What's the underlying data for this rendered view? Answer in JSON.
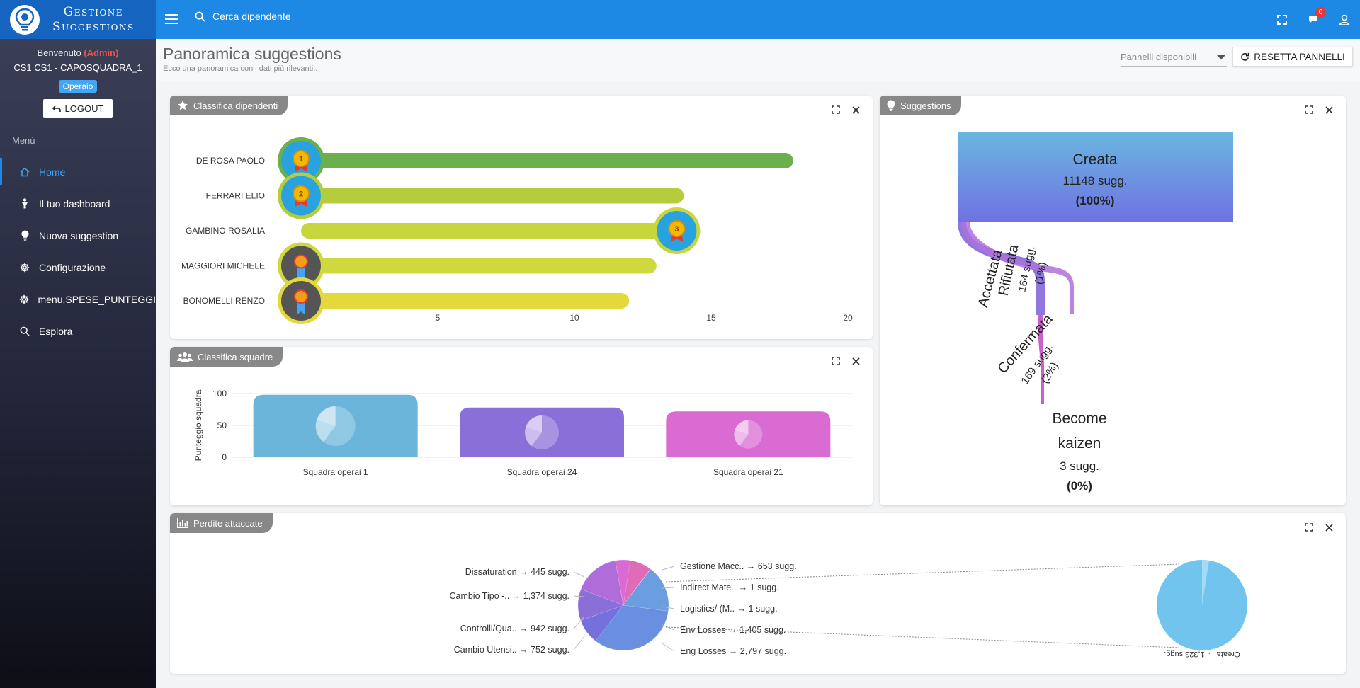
{
  "brand": {
    "line1": "Gestione",
    "line2": "Suggestions"
  },
  "topbar": {
    "search_placeholder": "Cerca dipendente",
    "icons": [
      "fullscreen-icon",
      "chat-icon",
      "user-icon"
    ],
    "notifications_count": "0",
    "colors": {
      "bar": "#1e88e5",
      "brand": "#1565c0",
      "badge": "#e53935"
    }
  },
  "sidebar": {
    "welcome": "Benvenuto",
    "admin": "(Admin)",
    "user": "CS1 CS1 - CAPOSQUADRA_1",
    "role": "Operaio",
    "logout": "LOGOUT",
    "menu_title": "Menù",
    "items": [
      {
        "label": "Home",
        "icon": "home-icon",
        "active": true
      },
      {
        "label": "Il tuo dashboard",
        "icon": "person-icon",
        "active": false
      },
      {
        "label": "Nuova suggestion",
        "icon": "lightbulb-icon",
        "active": false
      },
      {
        "label": "Configurazione",
        "icon": "gear-icon",
        "active": false
      },
      {
        "label": "menu.SPESE_PUNTEGGI",
        "icon": "gear-icon",
        "active": false
      },
      {
        "label": "Esplora",
        "icon": "search-icon",
        "active": false
      }
    ]
  },
  "header": {
    "title": "Panoramica suggestions",
    "subtitle": "Ecco una panoramica con i dati più rilevanti..",
    "select_placeholder": "Pannelli disponibili",
    "reset": "RESETTA PANNELLI"
  },
  "cards": {
    "dipendenti": {
      "title": "Classifica dipendenti",
      "icon": "star-icon"
    },
    "squadre": {
      "title": "Classifica squadre",
      "icon": "group-icon"
    },
    "suggestions": {
      "title": "Suggestions",
      "icon": "lightbulb-icon"
    },
    "perdite": {
      "title": "Perdite attaccate",
      "icon": "bar-chart-icon"
    }
  },
  "chart_data": [
    {
      "id": "classifica-dipendenti",
      "type": "bar",
      "orientation": "horizontal",
      "categories": [
        "DE ROSA PAOLO",
        "FERRARI ELIO",
        "GAMBINO ROSALIA",
        "MAGGIORI MICHELE",
        "BONOMELLI RENZO"
      ],
      "values": [
        18,
        14,
        14,
        13,
        12
      ],
      "medals": [
        "1",
        "2",
        "3",
        "",
        ""
      ],
      "colors": [
        "#6ab04c",
        "#b5cc3c",
        "#c8d63e",
        "#cfd83c",
        "#e3d93a"
      ],
      "xticks": [
        "0",
        "5",
        "10",
        "15",
        "20"
      ],
      "xlim": [
        0,
        20
      ]
    },
    {
      "id": "classifica-squadre",
      "type": "bar",
      "categories": [
        "Squadra operai 1",
        "Squadra operai 24",
        "Squadra operai 21"
      ],
      "values": [
        98,
        78,
        72
      ],
      "colors": [
        "#6bb5da",
        "#8b6fd8",
        "#d96bd2"
      ],
      "ylabel": "Punteggio squadra",
      "yticks": [
        "0",
        "50",
        "100"
      ],
      "ylim": [
        0,
        100
      ]
    },
    {
      "id": "suggestions-flow",
      "type": "sankey",
      "nodes": [
        {
          "name": "Creata",
          "count": "11148 sugg.",
          "pct": "(100%)"
        },
        {
          "name": "Accettata",
          "count": "",
          "pct": ""
        },
        {
          "name": "Rifiutata",
          "count": "",
          "pct": ""
        },
        {
          "name": "",
          "count": "164 sugg.",
          "pct": "(1%)"
        },
        {
          "name": "Confermata",
          "count": "169 sugg.",
          "pct": "(2%)"
        },
        {
          "name": "Become kaizen",
          "count": "3 sugg.",
          "pct": "(0%)"
        }
      ],
      "colors": [
        "#6aaee0",
        "#7a6ee0",
        "#a65fd8",
        "#d060c8"
      ]
    },
    {
      "id": "perdite-attaccate",
      "type": "pie",
      "labels": [
        "Dissaturation → 445 sugg.",
        "Cambio Tipo -.. → 1,374 sugg.",
        "Controlli/Qua.. → 942 sugg.",
        "Cambio Utensi.. → 752 sugg.",
        "Gestione Macc.. → 653 sugg.",
        "Indirect Mate.. → 1 sugg.",
        "Logistics/ (M.. → 1 sugg.",
        "Env Losses → 1,405 sugg.",
        "Eng Losses → 2,797 sugg."
      ],
      "values": [
        445,
        1374,
        942,
        752,
        653,
        1,
        1,
        1405,
        2797
      ],
      "secondary": {
        "labels": [
          "Creata → 1,323 sugg."
        ],
        "values": [
          1323
        ]
      },
      "colors": [
        "#d96bd2",
        "#b06cd8",
        "#8b6fd8",
        "#7670dc",
        "#e06bb8",
        "#c860d0",
        "#7ab8e0",
        "#6a9ee0",
        "#6b8fe0"
      ]
    }
  ]
}
